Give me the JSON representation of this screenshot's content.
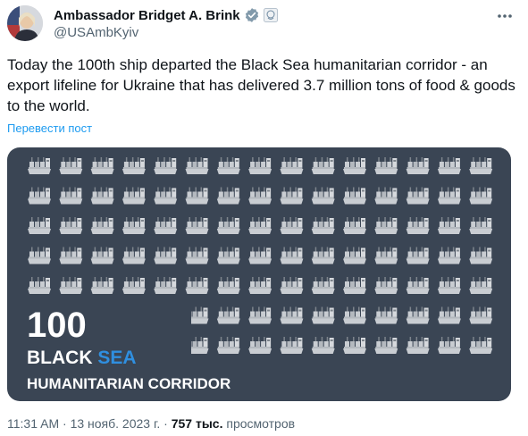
{
  "author": {
    "display_name": "Ambassador Bridget A. Brink",
    "handle": "@USAmbKyiv"
  },
  "tweet": {
    "text": "Today the 100th ship departed the Black Sea humanitarian corridor - an export lifeline for Ukraine that has delivered 3.7 million tons of food & goods to the world.",
    "translate_label": "Перевести пост"
  },
  "image": {
    "ship_count": 100,
    "headline_number": "100",
    "line1_part1": "BLACK ",
    "line1_part2": "SEA",
    "line2": "HUMANITARIAN CORRIDOR",
    "colors": {
      "background": "#3a4554",
      "ship": "#c9cdd2",
      "ship_dark": "#7d848c",
      "text": "#ffffff",
      "accent": "#2f8fe0"
    }
  },
  "footer": {
    "time": "11:31 AM",
    "sep1": " · ",
    "date": "13 нояб. 2023 г.",
    "sep2": " · ",
    "views_count": "757 тыс.",
    "views_label": " просмотров"
  },
  "icons": [
    "verified-badge-icon",
    "government-badge-icon",
    "more-options-icon",
    "ship-icon"
  ]
}
